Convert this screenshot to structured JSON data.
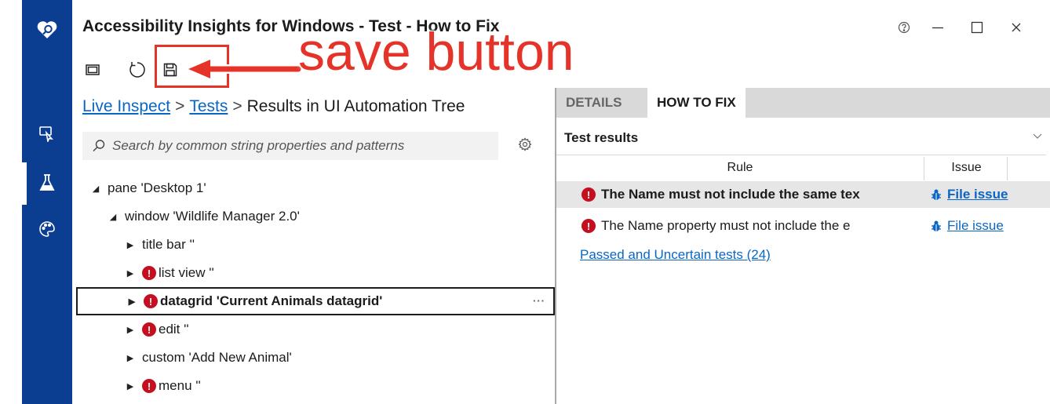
{
  "app": {
    "title": "Accessibility Insights for Windows - Test - How to Fix"
  },
  "window_controls": {
    "help_icon": "help-circle-icon",
    "minimize_icon": "minimize-icon",
    "maximize_icon": "maximize-icon",
    "close_icon": "close-icon"
  },
  "rail": {
    "items": [
      {
        "icon": "accessibility-insights-logo"
      },
      {
        "icon": "live-inspect-icon"
      },
      {
        "icon": "test-beaker-icon"
      },
      {
        "icon": "color-palette-icon"
      }
    ]
  },
  "toolbar": {
    "window_icon": "window-icon",
    "refresh_icon": "refresh-icon",
    "save_icon": "save-icon"
  },
  "annotation": {
    "text": "save button",
    "color": "#e6332a"
  },
  "breadcrumb": {
    "items": [
      "Live Inspect",
      "Tests",
      "Results in UI Automation Tree"
    ],
    "separator": ">"
  },
  "search": {
    "placeholder": "Search by common string properties and patterns"
  },
  "tree": {
    "nodes": [
      {
        "label": "pane 'Desktop 1'",
        "expanded": true,
        "error": false
      },
      {
        "label": "window 'Wildlife Manager 2.0'",
        "expanded": true,
        "error": false
      },
      {
        "label": "title bar ''",
        "expanded": false,
        "error": false
      },
      {
        "label": "list view ''",
        "expanded": false,
        "error": true
      },
      {
        "label": "datagrid 'Current Animals datagrid'",
        "expanded": false,
        "error": true,
        "selected": true
      },
      {
        "label": "edit ''",
        "expanded": false,
        "error": true
      },
      {
        "label": "custom 'Add New Animal'",
        "expanded": false,
        "error": false
      },
      {
        "label": "menu ''",
        "expanded": false,
        "error": true
      }
    ],
    "more_label": "···"
  },
  "tabs": {
    "details": "DETAILS",
    "how_to_fix": "HOW TO FIX"
  },
  "results": {
    "header": "Test results",
    "columns": {
      "rule": "Rule",
      "issue": "Issue"
    },
    "rows": [
      {
        "rule": "The Name must not include the same tex",
        "issue": "File issue",
        "selected": true
      },
      {
        "rule": "The Name property must not include the e",
        "issue": "File issue",
        "selected": false
      }
    ],
    "passed_link": "Passed and Uncertain tests (24)"
  },
  "colors": {
    "rail": "#0b3d91",
    "error": "#c50f1f",
    "link": "#0b66c3",
    "annotation": "#e6332a"
  }
}
